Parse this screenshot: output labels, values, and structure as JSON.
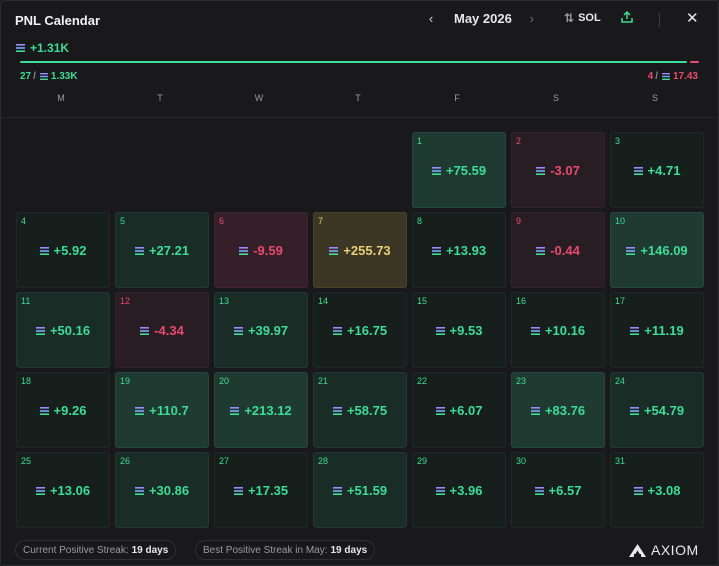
{
  "header": {
    "title": "PNL Calendar",
    "month": "May 2026",
    "unit": "SOL",
    "prev_icon": "chevron-left-icon",
    "next_icon": "chevron-right-icon",
    "share_icon": "share-icon",
    "close_icon": "close-icon",
    "sort_icon": "swap-icon"
  },
  "summary": {
    "total": "+1.31K",
    "wins_count": "27",
    "wins_value": "1.33K",
    "losses_count": "4",
    "losses_value": "17.43",
    "win_ratio": 0.986
  },
  "weekdays": [
    "M",
    "T",
    "W",
    "T",
    "F",
    "S",
    "S"
  ],
  "days": [
    {
      "day": "1",
      "value": "+75.59",
      "tone": "g2"
    },
    {
      "day": "2",
      "value": "-3.07",
      "tone": "r1"
    },
    {
      "day": "3",
      "value": "+4.71",
      "tone": "g0"
    },
    {
      "day": "4",
      "value": "+5.92",
      "tone": "g0"
    },
    {
      "day": "5",
      "value": "+27.21",
      "tone": "g1"
    },
    {
      "day": "6",
      "value": "-9.59",
      "tone": "r2"
    },
    {
      "day": "7",
      "value": "+255.73",
      "tone": "y"
    },
    {
      "day": "8",
      "value": "+13.93",
      "tone": "g0"
    },
    {
      "day": "9",
      "value": "-0.44",
      "tone": "r1"
    },
    {
      "day": "10",
      "value": "+146.09",
      "tone": "g2"
    },
    {
      "day": "11",
      "value": "+50.16",
      "tone": "g1"
    },
    {
      "day": "12",
      "value": "-4.34",
      "tone": "r1"
    },
    {
      "day": "13",
      "value": "+39.97",
      "tone": "g1"
    },
    {
      "day": "14",
      "value": "+16.75",
      "tone": "g0"
    },
    {
      "day": "15",
      "value": "+9.53",
      "tone": "g0"
    },
    {
      "day": "16",
      "value": "+10.16",
      "tone": "g0"
    },
    {
      "day": "17",
      "value": "+11.19",
      "tone": "g0"
    },
    {
      "day": "18",
      "value": "+9.26",
      "tone": "g0"
    },
    {
      "day": "19",
      "value": "+110.7",
      "tone": "g2"
    },
    {
      "day": "20",
      "value": "+213.12",
      "tone": "g2"
    },
    {
      "day": "21",
      "value": "+58.75",
      "tone": "g1"
    },
    {
      "day": "22",
      "value": "+6.07",
      "tone": "g0"
    },
    {
      "day": "23",
      "value": "+83.76",
      "tone": "g2"
    },
    {
      "day": "24",
      "value": "+54.79",
      "tone": "g1"
    },
    {
      "day": "25",
      "value": "+13.06",
      "tone": "g0"
    },
    {
      "day": "26",
      "value": "+30.86",
      "tone": "g1"
    },
    {
      "day": "27",
      "value": "+17.35",
      "tone": "g0"
    },
    {
      "day": "28",
      "value": "+51.59",
      "tone": "g1"
    },
    {
      "day": "29",
      "value": "+3.96",
      "tone": "g0"
    },
    {
      "day": "30",
      "value": "+6.57",
      "tone": "g0"
    },
    {
      "day": "31",
      "value": "+3.08",
      "tone": "g0"
    }
  ],
  "footer": {
    "current_streak_label": "Current Positive Streak:",
    "current_streak_value": "19 days",
    "best_streak_label": "Best Positive Streak in May:",
    "best_streak_value": "19 days",
    "brand": "AXIOM"
  },
  "colors": {
    "positive": "#3ddc97",
    "negative": "#e84a6f",
    "highlight": "#e9cd77"
  }
}
